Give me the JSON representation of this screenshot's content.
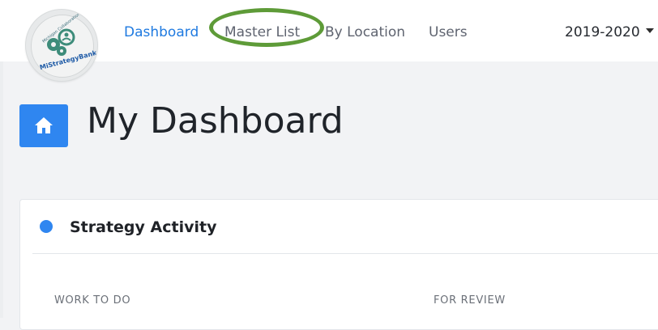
{
  "brand": {
    "logo_icon": "mistrategybank-logo",
    "logo_text": "MiStrategyBank",
    "logo_subtext": "Michigan Collaboration Hub",
    "accent_color": "#2f86f0",
    "highlight_color": "#5e9b38"
  },
  "nav": {
    "items": [
      {
        "label": "Dashboard",
        "active": true
      },
      {
        "label": "Master List",
        "active": false
      },
      {
        "label": "By Location",
        "active": false
      },
      {
        "label": "Users",
        "active": false
      }
    ]
  },
  "year_selector": {
    "value": "2019-2020",
    "icon": "caret-down-icon"
  },
  "page": {
    "title": "My Dashboard",
    "title_icon": "home-icon"
  },
  "card": {
    "title": "Strategy Activity",
    "dot_color": "#2f86f0",
    "columns": [
      {
        "label": "WORK TO DO"
      },
      {
        "label": "FOR REVIEW"
      }
    ]
  }
}
